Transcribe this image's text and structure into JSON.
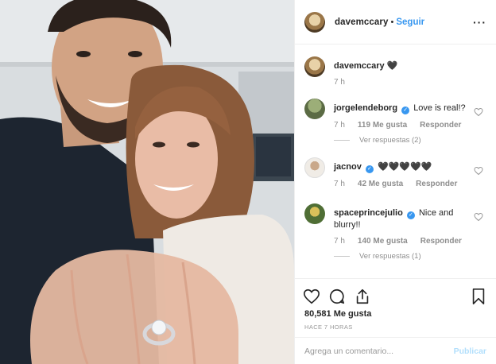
{
  "header": {
    "username": "davemccary",
    "separator": "•",
    "follow_label": "Seguir",
    "more_label": "···"
  },
  "caption": {
    "username": "davemccary",
    "text": "🖤",
    "time": "7 h"
  },
  "comments": [
    {
      "username": "jorgelendeborg",
      "verified": true,
      "text": "Love is real!?",
      "time": "7 h",
      "likes": "119 Me gusta",
      "reply_label": "Responder",
      "replies_label": "Ver respuestas (2)",
      "avatar_color": "#6b7a54"
    },
    {
      "username": "jacnov",
      "verified": true,
      "text": "🖤🖤🖤🖤🖤",
      "time": "7 h",
      "likes": "42 Me gusta",
      "reply_label": "Responder",
      "avatar_color": "#e9e4da"
    },
    {
      "username": "spaceprincejulio",
      "verified": true,
      "text": "Nice and blurry!!",
      "time": "7 h",
      "likes": "140 Me gusta",
      "reply_label": "Responder",
      "replies_label": "Ver respuestas (1)",
      "avatar_color": "#5a7a3a"
    }
  ],
  "actions": {
    "like_icon": "heart-icon",
    "comment_icon": "comment-icon",
    "share_icon": "share-icon",
    "save_icon": "bookmark-icon"
  },
  "likes_count": "80,581 Me gusta",
  "time_ago": "HACE 7 HORAS",
  "add_comment": {
    "placeholder": "Agrega un comentario...",
    "publish_label": "Publicar"
  },
  "colors": {
    "link_blue": "#3897f0",
    "publish_disabled": "#b2dffc",
    "muted_text": "#8e8e8e"
  }
}
